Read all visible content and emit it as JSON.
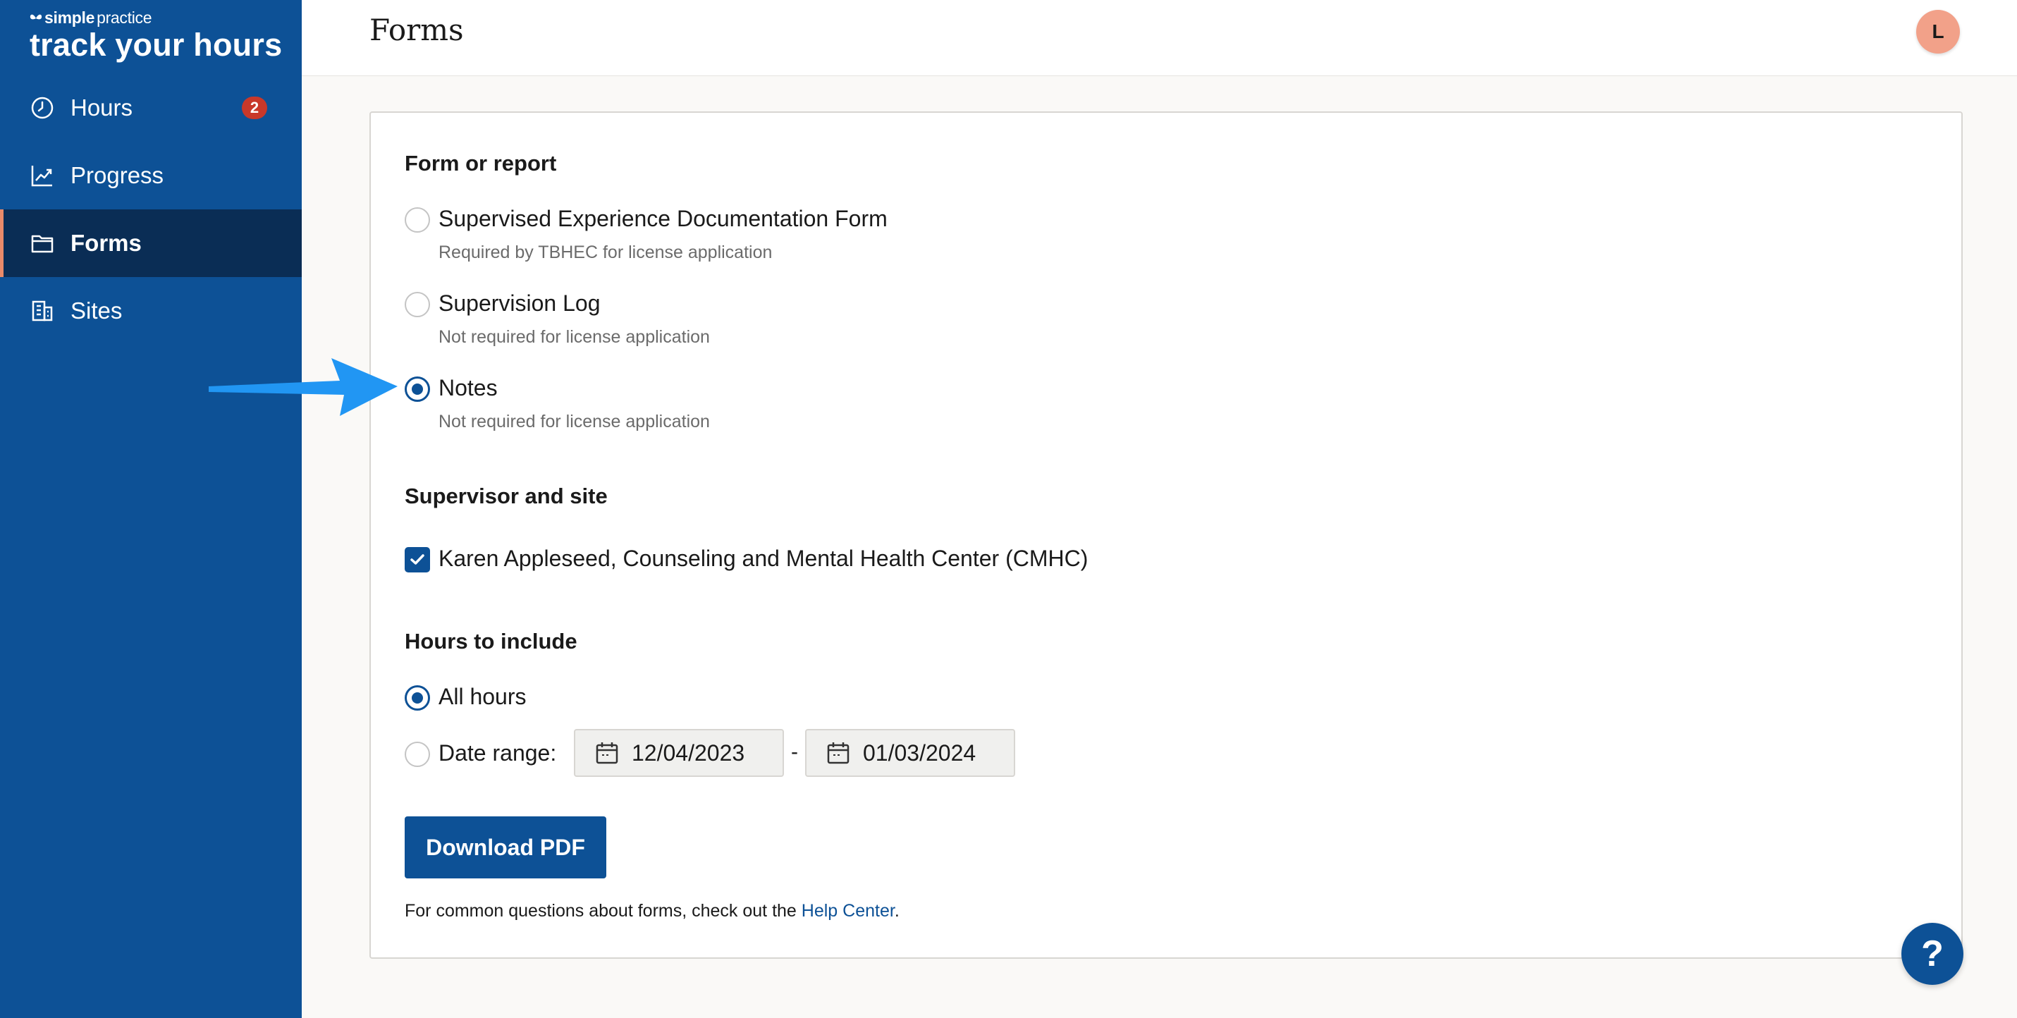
{
  "brand": {
    "small_bold": "simple",
    "small_light": "practice",
    "big": "track your hours"
  },
  "sidebar": {
    "items": [
      {
        "label": "Hours",
        "icon": "clock-icon",
        "badge": "2"
      },
      {
        "label": "Progress",
        "icon": "chart-line-icon"
      },
      {
        "label": "Forms",
        "icon": "folder-icon",
        "active": true
      },
      {
        "label": "Sites",
        "icon": "building-icon"
      }
    ]
  },
  "header": {
    "title": "Forms",
    "avatar_initial": "L"
  },
  "form": {
    "form_section_title": "Form or report",
    "form_options": [
      {
        "label": "Supervised Experience Documentation Form",
        "sublabel": "Required by TBHEC for license application",
        "selected": false
      },
      {
        "label": "Supervision Log",
        "sublabel": "Not required for license application",
        "selected": false
      },
      {
        "label": "Notes",
        "sublabel": "Not required for license application",
        "selected": true
      }
    ],
    "supervisor_section_title": "Supervisor and site",
    "supervisor_option": {
      "label": "Karen Appleseed, Counseling and Mental Health Center (CMHC)",
      "checked": true
    },
    "hours_section_title": "Hours to include",
    "hours_options": {
      "all_hours_label": "All hours",
      "date_range_label": "Date range:",
      "start_date": "12/04/2023",
      "range_separator": "-",
      "end_date": "01/03/2024",
      "selected": "all_hours"
    },
    "download_button_label": "Download PDF",
    "help_text_prefix": "For common questions about forms, check out the ",
    "help_link_label": "Help Center",
    "help_text_suffix": "."
  },
  "help_fab_label": "?",
  "colors": {
    "primary": "#0d5196",
    "sidebar_active": "#0a2d55",
    "badge": "#c8382a",
    "avatar": "#f2a189",
    "arrow": "#2196f3"
  }
}
